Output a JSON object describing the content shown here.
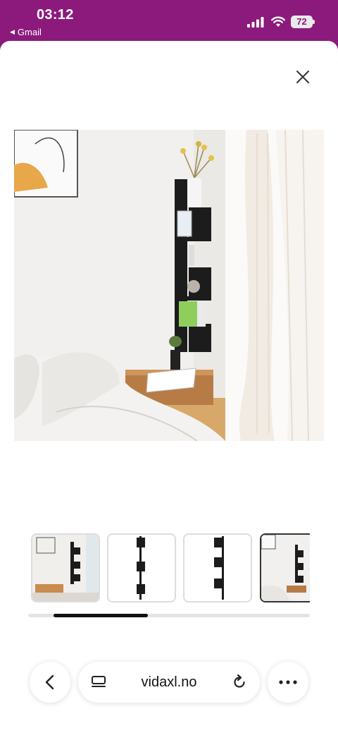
{
  "status_bar": {
    "time": "03:12",
    "back_app": "Gmail",
    "battery": "72",
    "background_color": "#8b1a7c"
  },
  "viewer": {
    "close_icon": "close-icon",
    "main_image_icon": "product-photo-corner-shelf",
    "thumbnails": [
      {
        "icon": "thumb-wall-shelf-room"
      },
      {
        "icon": "thumb-shelf-side-view"
      },
      {
        "icon": "thumb-shelf-back-view"
      },
      {
        "icon": "thumb-shelf-bedroom",
        "selected": true
      }
    ],
    "thumbnail_scroll_position": 0.09
  },
  "browser_bar": {
    "url": "vidaxl.no",
    "back_icon": "chevron-left-icon",
    "reader_icon": "reader-icon",
    "reload_icon": "reload-icon",
    "more_icon": "more-icon"
  }
}
